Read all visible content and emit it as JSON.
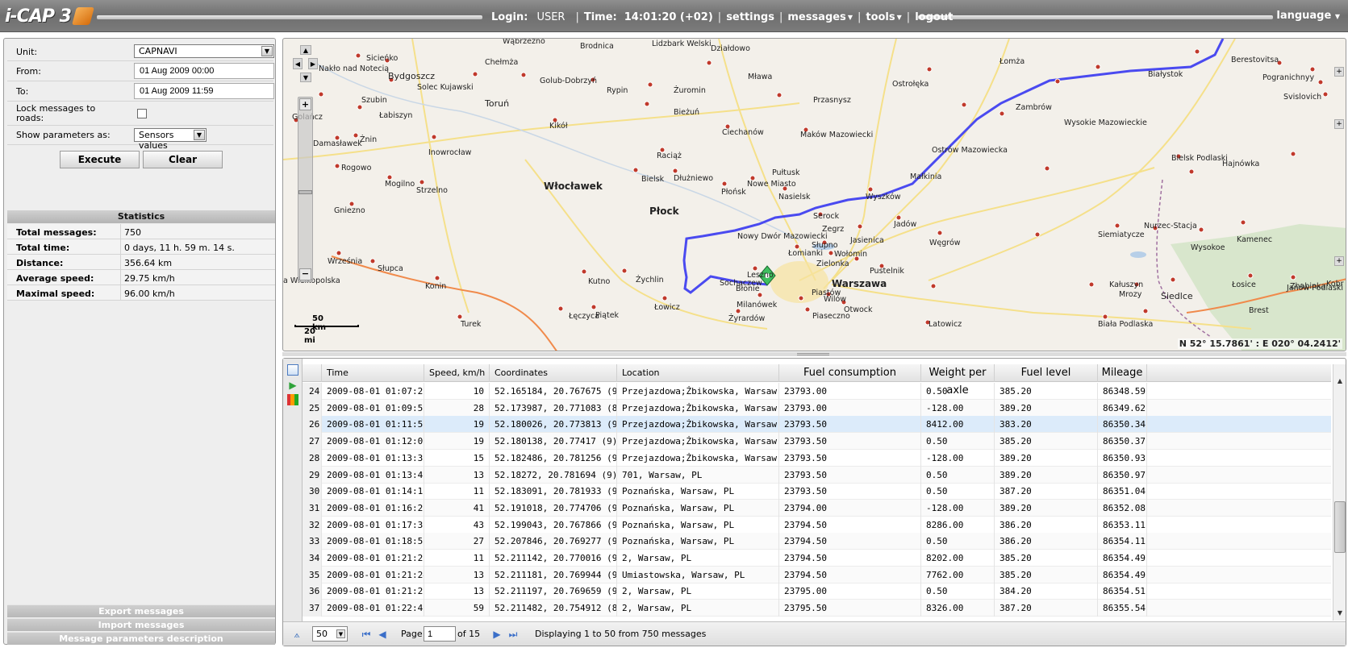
{
  "app": {
    "logo_text": "i-CAP 3",
    "login_label": "Login:",
    "login_user": "USER",
    "time_label": "Time:",
    "time_value": "14:01:20 (+02)",
    "menu": {
      "settings": "settings",
      "messages": "messages",
      "tools": "tools",
      "logout": "logout"
    },
    "language": "language"
  },
  "form": {
    "unit_label": "Unit:",
    "unit_value": "CAPNAVI",
    "from_label": "From:",
    "from_value": "01 Aug 2009 00:00",
    "to_label": "To:",
    "to_value": "01 Aug 2009 11:59",
    "lock_label": "Lock messages to roads:",
    "show_params_label": "Show parameters as:",
    "show_params_value": "Sensors values",
    "execute": "Execute",
    "clear": "Clear"
  },
  "statistics": {
    "header": "Statistics",
    "rows": [
      {
        "key": "Total messages:",
        "value": "750"
      },
      {
        "key": "Total time:",
        "value": "0 days, 11 h. 59 m. 14 s."
      },
      {
        "key": "Distance:",
        "value": "356.64 km"
      },
      {
        "key": "Average speed:",
        "value": "29.75 km/h"
      },
      {
        "key": "Maximal speed:",
        "value": "96.00 km/h"
      }
    ]
  },
  "bottom_links": {
    "export": "Export messages",
    "import": "Import messages",
    "params_desc": "Message parameters description"
  },
  "map": {
    "scale_km": "50 km",
    "scale_mi": "20 mi",
    "coordinates": "N 52° 15.7861' : E 020° 04.2412'",
    "labels": [
      "Wąbrzeźno",
      "Brodnica",
      "Lidzbark Welski",
      "Działdowo",
      "Sicieńko",
      "Nakło nad Notecią",
      "Bydgoszcz",
      "Chełmża",
      "Solec Kujawski",
      "Toruń",
      "Golub-Dobrzyń",
      "Rypin",
      "Żuromin",
      "Mława",
      "Łomża",
      "Ostrołęka",
      "Białystok",
      "Szubin",
      "Łabiszyn",
      "Bieżuń",
      "Przasnysz",
      "Zambrów",
      "Wysokie Mazowieckie",
      "Golańcz",
      "Kikół",
      "Ciechanów",
      "Maków Mazowiecki",
      "Damasławek",
      "Żnin",
      "Inowrocław",
      "Raciąż",
      "Ostrów Mazowiecka",
      "Rogowo",
      "Bielsk",
      "Dłużniewo",
      "Pułtusk",
      "Małkinia",
      "Bielsk Podlaski",
      "Hajnówka",
      "Mogilno",
      "Strzelno",
      "Włocławek",
      "Płońsk",
      "Nowe Miasto",
      "Nasielsk",
      "Wyszków",
      "Gniezno",
      "Płock",
      "Serock",
      "Jadów",
      "Nowy Dwór Mazowiecki",
      "Zegrz",
      "Jasienica",
      "Węgrów",
      "Siemiatycze",
      "Nurzec-Stacja",
      "Wysokoe",
      "Kamenec",
      "Łomianki",
      "Słupno",
      "Wołomin",
      "Zielonka",
      "Pustelnik",
      "Września",
      "Słupca",
      "Leszno",
      "Sochaczew",
      "Błonie",
      "Warszawa",
      "Kutno",
      "Żychlin",
      "Piastów",
      "Kałuszyn",
      "Mrozy",
      "Łosice",
      "Janów Podlaski",
      "Siedlce",
      "a Wielkopolska",
      "Konin",
      "Milanówek",
      "Wilów",
      "Otwock",
      "Brest",
      "Łowicz",
      "Łęczyca",
      "Piątek",
      "Żyrardów",
      "Piaseczno",
      "Turek",
      "Latowicz",
      "Biała Podlaska",
      "Berestovitsa",
      "Pogranichnyy",
      "Svislovich",
      "Zhabinka",
      "Kobr"
    ]
  },
  "grid": {
    "columns": [
      "",
      "Time",
      "Speed, km/h",
      "Coordinates",
      "Location",
      "Fuel consumption",
      "Weight per axle",
      "Fuel level",
      "Mileage"
    ],
    "rows": [
      [
        "24",
        "2009-08-01 01:07:26",
        "10",
        "52.165184, 20.767675 (9)",
        "Przejazdowa;Żbikowska, Warsaw, PL",
        "23793.00",
        "0.50",
        "385.20",
        "86348.59"
      ],
      [
        "25",
        "2009-08-01 01:09:51",
        "28",
        "52.173987, 20.771083 (8)",
        "Przejazdowa;Żbikowska, Warsaw, PL",
        "23793.00",
        "-128.00",
        "389.20",
        "86349.62"
      ],
      [
        "26",
        "2009-08-01 01:11:55",
        "19",
        "52.180026, 20.773813 (9)",
        "Przejazdowa;Żbikowska, Warsaw, PL",
        "23793.50",
        "8412.00",
        "383.20",
        "86350.34"
      ],
      [
        "27",
        "2009-08-01 01:12:00",
        "19",
        "52.180138, 20.77417 (9)",
        "Przejazdowa;Żbikowska, Warsaw, PL",
        "23793.50",
        "0.50",
        "385.20",
        "86350.37"
      ],
      [
        "28",
        "2009-08-01 01:13:33",
        "15",
        "52.182486, 20.781256 (9)",
        "Przejazdowa;Żbikowska, Warsaw, PL",
        "23793.50",
        "-128.00",
        "389.20",
        "86350.93"
      ],
      [
        "29",
        "2009-08-01 01:13:45",
        "13",
        "52.18272, 20.781694 (9)",
        "701, Warsaw, PL",
        "23793.50",
        "0.50",
        "389.20",
        "86350.97"
      ],
      [
        "30",
        "2009-08-01 01:14:11",
        "11",
        "52.183091, 20.781933 (9)",
        "Poznańska, Warsaw, PL",
        "23793.50",
        "0.50",
        "387.20",
        "86351.04"
      ],
      [
        "31",
        "2009-08-01 01:16:21",
        "41",
        "52.191018, 20.774706 (9)",
        "Poznańska, Warsaw, PL",
        "23794.00",
        "-128.00",
        "389.20",
        "86352.08"
      ],
      [
        "32",
        "2009-08-01 01:17:38",
        "43",
        "52.199043, 20.767866 (9)",
        "Poznańska, Warsaw, PL",
        "23794.50",
        "8286.00",
        "386.20",
        "86353.11"
      ],
      [
        "33",
        "2009-08-01 01:18:52",
        "27",
        "52.207846, 20.769277 (9)",
        "Poznańska, Warsaw, PL",
        "23794.50",
        "0.50",
        "386.20",
        "86354.11"
      ],
      [
        "34",
        "2009-08-01 01:21:21",
        "11",
        "52.211142, 20.770016 (9)",
        "2, Warsaw, PL",
        "23794.50",
        "8202.00",
        "385.20",
        "86354.49"
      ],
      [
        "35",
        "2009-08-01 01:21:24",
        "13",
        "52.211181, 20.769944 (9)",
        "Umiastowska, Warsaw, PL",
        "23794.50",
        "7762.00",
        "385.20",
        "86354.49"
      ],
      [
        "36",
        "2009-08-01 01:21:29",
        "13",
        "52.211197, 20.769659 (9)",
        "2, Warsaw, PL",
        "23795.00",
        "0.50",
        "384.20",
        "86354.51"
      ],
      [
        "37",
        "2009-08-01 01:22:41",
        "59",
        "52.211482, 20.754912 (8)",
        "2, Warsaw, PL",
        "23795.50",
        "8326.00",
        "387.20",
        "86355.54"
      ]
    ]
  },
  "pager": {
    "page_size": "50",
    "page_label": "Page",
    "page_value": "1",
    "of_label": "of 15",
    "display_info": "Displaying 1 to 50 from 750 messages"
  },
  "colors": {
    "track": "#4a4af0",
    "selected_row": "#dcebfa",
    "road": "#f08a4b",
    "marker": "#3fbf5f"
  }
}
